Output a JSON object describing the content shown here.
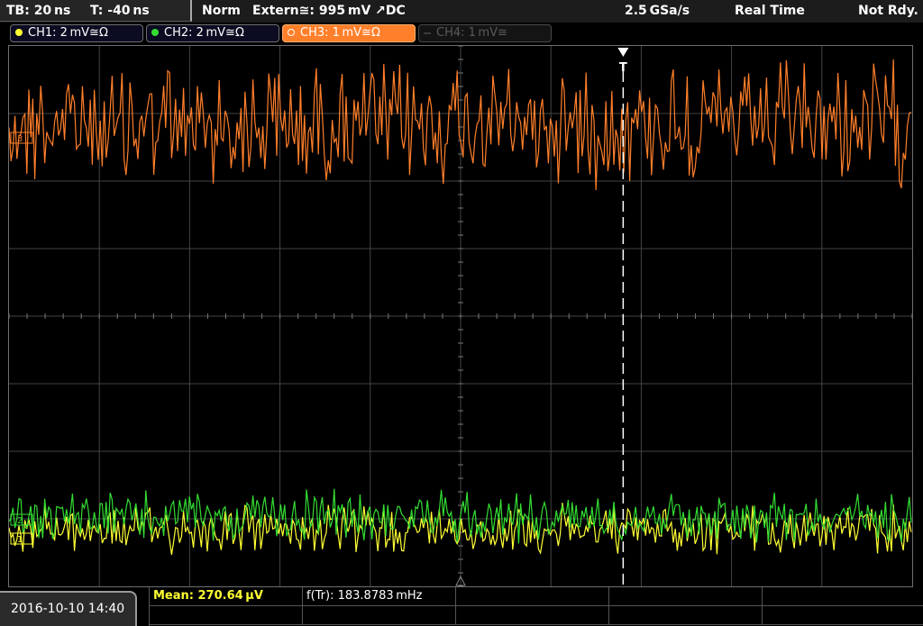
{
  "status_bar": {
    "timebase": "TB: 20 ns",
    "trigger_time": "T: -40 ns",
    "trigger_mode": "Norm",
    "trigger_source": "Extern≅: 995 mV ↗DC",
    "sample_rate": "2.5 GSa/s",
    "acq_mode": "Real Time",
    "trigger_state": "Not Rdy."
  },
  "channels": [
    {
      "label": "CH1: 2 mV≅Ω",
      "color": "#ffff33",
      "state": "on"
    },
    {
      "label": "CH2: 2 mV≅Ω",
      "color": "#33dd33",
      "state": "on"
    },
    {
      "label": "CH3: 1 mV≅Ω",
      "color": "#ff7f2a",
      "state": "active"
    },
    {
      "label": "CH4: 1 mV≅",
      "color": "#444444",
      "state": "off"
    }
  ],
  "waveform": {
    "trigger_marker": "T",
    "ch3_marker": "3",
    "ch2_marker": "2",
    "ch1_marker": "1",
    "trigger_level_fraction": 0.68,
    "colors": {
      "ch1": "#ffff33",
      "ch2": "#33dd33",
      "ch3": "#ff7f2a",
      "grid": "#444444"
    }
  },
  "footer": {
    "datetime": "2016-10-10 14:40",
    "measurements": [
      {
        "label": "Mean: 270.64 µV",
        "color": "#ffff33"
      },
      {
        "label": "f(Tr): 183.8783 mHz",
        "color": "#ffffff"
      }
    ]
  }
}
